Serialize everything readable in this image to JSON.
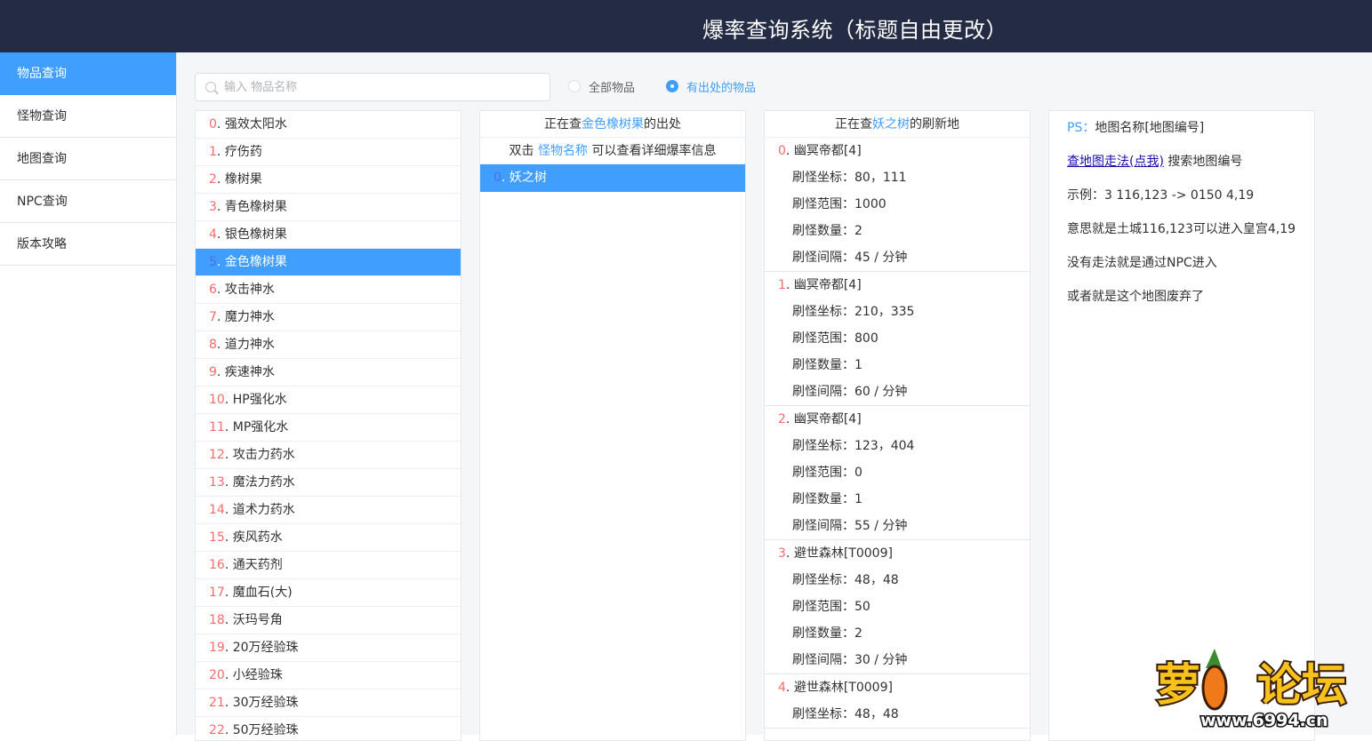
{
  "header": {
    "title": "爆率查询系统（标题自由更改）"
  },
  "sidebar": {
    "items": [
      {
        "label": "物品查询",
        "active": true
      },
      {
        "label": "怪物查询",
        "active": false
      },
      {
        "label": "地图查询",
        "active": false
      },
      {
        "label": "NPC查询",
        "active": false
      },
      {
        "label": "版本攻略",
        "active": false
      }
    ]
  },
  "search": {
    "placeholder": "输入 物品名称",
    "value": ""
  },
  "filters": [
    {
      "label": "全部物品",
      "checked": false
    },
    {
      "label": "有出处的物品",
      "checked": true
    }
  ],
  "items": [
    {
      "idx": "0",
      "name": "强效太阳水"
    },
    {
      "idx": "1",
      "name": "疗伤药"
    },
    {
      "idx": "2",
      "name": "橡树果"
    },
    {
      "idx": "3",
      "name": "青色橡树果"
    },
    {
      "idx": "4",
      "name": "银色橡树果"
    },
    {
      "idx": "5",
      "name": "金色橡树果",
      "selected": true
    },
    {
      "idx": "6",
      "name": "攻击神水"
    },
    {
      "idx": "7",
      "name": "魔力神水"
    },
    {
      "idx": "8",
      "name": "道力神水"
    },
    {
      "idx": "9",
      "name": "疾速神水"
    },
    {
      "idx": "10",
      "name": "HP强化水"
    },
    {
      "idx": "11",
      "name": "MP强化水"
    },
    {
      "idx": "12",
      "name": "攻击力药水"
    },
    {
      "idx": "13",
      "name": "魔法力药水"
    },
    {
      "idx": "14",
      "name": "道术力药水"
    },
    {
      "idx": "15",
      "name": "疾风药水"
    },
    {
      "idx": "16",
      "name": "通天药剂"
    },
    {
      "idx": "17",
      "name": "魔血石(大)"
    },
    {
      "idx": "18",
      "name": "沃玛号角"
    },
    {
      "idx": "19",
      "name": "20万经验珠"
    },
    {
      "idx": "20",
      "name": "小经验珠"
    },
    {
      "idx": "21",
      "name": "30万经验珠"
    },
    {
      "idx": "22",
      "name": "50万经验珠"
    }
  ],
  "monsters_panel": {
    "header_prefix": "正在查",
    "header_item": "金色橡树果",
    "header_suffix": "的出处",
    "hint_prefix": "双击 ",
    "hint_link": "怪物名称",
    "hint_suffix": " 可以查看详细爆率信息",
    "list": [
      {
        "idx": "0",
        "name": "妖之树"
      }
    ]
  },
  "spawns_panel": {
    "header_prefix": "正在查",
    "header_monster": "妖之树",
    "header_suffix": "的刷新地",
    "coord_label": "刷怪坐标：",
    "range_label": "刷怪范围：",
    "count_label": "刷怪数量：",
    "interval_label": "刷怪间隔：",
    "list": [
      {
        "idx": "0",
        "map": "幽冥帝都[4]",
        "coord": "80，111",
        "range": "1000",
        "count": "2",
        "interval": "45 / 分钟"
      },
      {
        "idx": "1",
        "map": "幽冥帝都[4]",
        "coord": "210，335",
        "range": "800",
        "count": "1",
        "interval": "60 / 分钟"
      },
      {
        "idx": "2",
        "map": "幽冥帝都[4]",
        "coord": "123，404",
        "range": "0",
        "count": "1",
        "interval": "55 / 分钟"
      },
      {
        "idx": "3",
        "map": "避世森林[T0009]",
        "coord": "48，48",
        "range": "50",
        "count": "2",
        "interval": "30 / 分钟"
      },
      {
        "idx": "4",
        "map": "避世森林[T0009]",
        "coord": "48，48",
        "range": "",
        "count": "",
        "interval": ""
      }
    ]
  },
  "info_panel": {
    "ps_label": "PS：",
    "ps_text": "地图名称[地图编号]",
    "link_text": "查地图走法(点我)",
    "link_suffix": " 搜索地图编号",
    "example": "示例：3 116,123 -> 0150 4,19",
    "meaning": "意思就是土城116,123可以进入皇宫4,19",
    "no_route": "没有走法就是通过NPC进入",
    "abandoned": "或者就是这个地图废弃了"
  },
  "watermark": {
    "text": "萝卜论坛",
    "url": "www.6994.cn"
  },
  "colors": {
    "header_bg": "#232b45",
    "accent": "#409eff",
    "index_red": "#f56c6c"
  }
}
